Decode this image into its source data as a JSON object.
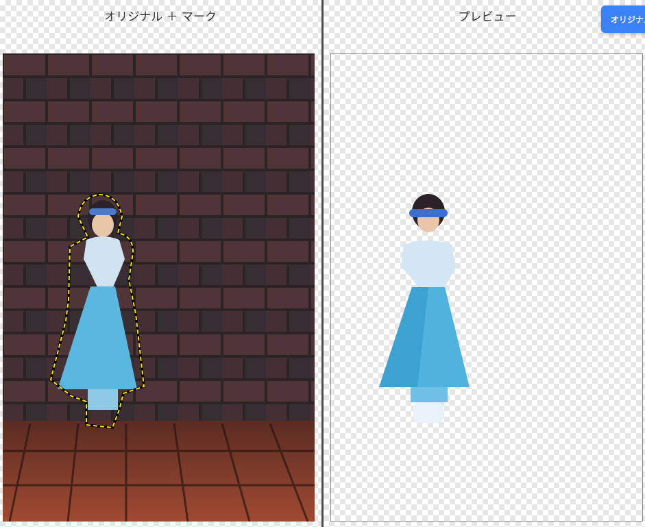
{
  "left_pane": {
    "title": "オリジナル ＋ マーク"
  },
  "right_pane": {
    "title": "プレビュー"
  },
  "toolbar": {
    "original_button_label": "オリジナル"
  },
  "colors": {
    "accent": "#3b82f6",
    "mark_outline": "#ffe600",
    "brick_wall": "#4a3033",
    "brick_floor": "#8a3d2a",
    "dress": "#5ab8e0"
  },
  "icons": {
    "subject": "girl-in-blue-dress-figure"
  }
}
